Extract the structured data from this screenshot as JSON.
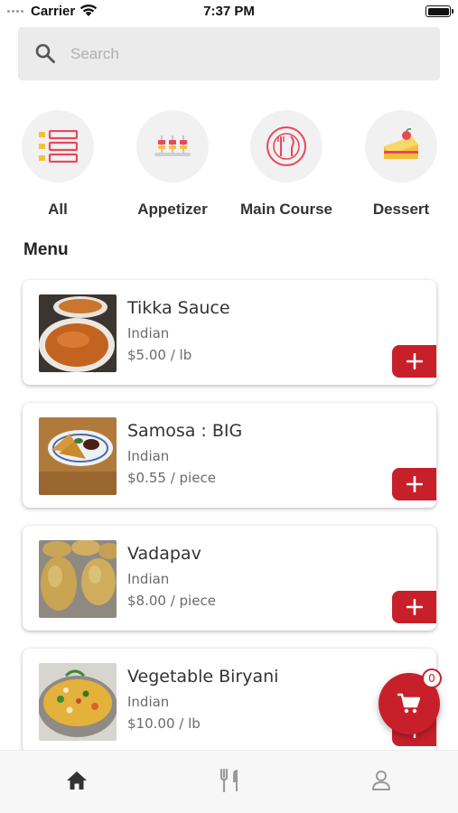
{
  "status_bar": {
    "carrier": "Carrier",
    "time": "7:37 PM"
  },
  "search": {
    "placeholder": "Search",
    "value": "",
    "icon": "search-icon"
  },
  "categories": [
    {
      "label": "All",
      "icon": "list-icon"
    },
    {
      "label": "Appetizer",
      "icon": "appetizer-icon"
    },
    {
      "label": "Main Course",
      "icon": "main-course-icon"
    },
    {
      "label": "Dessert",
      "icon": "dessert-icon"
    }
  ],
  "menu": {
    "title": "Menu",
    "items": [
      {
        "name": "Tikka Sauce",
        "cuisine": "Indian",
        "price": "$5.00 / lb"
      },
      {
        "name": "Samosa : BIG",
        "cuisine": "Indian",
        "price": "$0.55 / piece"
      },
      {
        "name": "Vadapav",
        "cuisine": "Indian",
        "price": "$8.00 / piece"
      },
      {
        "name": "Vegetable Biryani",
        "cuisine": "Indian",
        "price": "$10.00 / lb"
      }
    ]
  },
  "cart": {
    "count": "0",
    "icon": "cart-icon"
  },
  "bottom_nav": [
    {
      "name": "home",
      "icon": "home-icon",
      "active": true
    },
    {
      "name": "menu",
      "icon": "fork-knife-icon",
      "active": false
    },
    {
      "name": "profile",
      "icon": "user-icon",
      "active": false
    }
  ],
  "colors": {
    "accent": "#c8202a",
    "search_bg": "#ebebeb",
    "category_bg": "#f1f1f1",
    "category_icon": "#e8475b",
    "category_icon_secondary": "#f6c03c"
  }
}
